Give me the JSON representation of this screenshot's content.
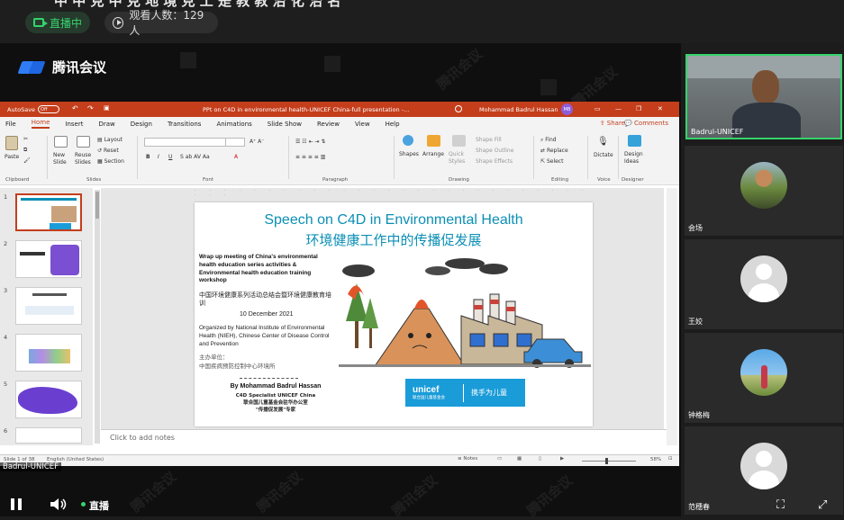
{
  "topbar": {
    "title_cut": "中 中 見 中 見 地 境 見 工 是 教 教 治 化 治 名",
    "live_label": "直播中",
    "viewers_label": "观看人数：129人"
  },
  "meeting": {
    "brand": "腾讯会议",
    "watermark": "腾讯会议",
    "presenter_label": "Badrul-UNICEF"
  },
  "ppt": {
    "autosave_label": "AutoSave",
    "autosave_state": "Off",
    "doc_title": "PPt on C4D in environmental health-UNICEF China-full presentation -...",
    "user_name": "Mohammad Badrul Hassan",
    "user_initials": "MB",
    "tabs": [
      "File",
      "Home",
      "Insert",
      "Draw",
      "Design",
      "Transitions",
      "Animations",
      "Slide Show",
      "Review",
      "View",
      "Help"
    ],
    "share_label": "Share",
    "comments_label": "Comments",
    "ribbon": {
      "paste": "Paste",
      "clipboard": "Clipboard",
      "new_slide": "New Slide",
      "reuse_slides": "Reuse Slides",
      "layout": "Layout",
      "reset": "Reset",
      "section": "Section",
      "slides": "Slides",
      "font": "Font",
      "paragraph": "Paragraph",
      "shapes": "Shapes",
      "arrange": "Arrange",
      "quick_styles": "Quick Styles",
      "shape_fill": "Shape Fill",
      "shape_outline": "Shape Outline",
      "shape_effects": "Shape Effects",
      "drawing": "Drawing",
      "find": "Find",
      "replace": "Replace",
      "select": "Select",
      "editing": "Editing",
      "dictate": "Dictate",
      "voice": "Voice",
      "design_ideas": "Design Ideas",
      "designer": "Designer"
    },
    "thumb_numbers": [
      "1",
      "2",
      "3",
      "4",
      "5",
      "6"
    ],
    "notes_placeholder": "Click to add notes",
    "status_slide": "Slide 1 of 38",
    "status_lang": "English (United States)",
    "status_notes": "Notes",
    "status_zoom": "58%"
  },
  "slide": {
    "title_en": "Speech on C4D in Environmental Health",
    "title_cn": "环境健康工作中的传播促发展",
    "meeting_en": "Wrap up meeting of China's environmental health education series activities & Environmental health education training workshop",
    "meeting_cn": "中国环境健康系列活动总结会暨环境健康教育培训",
    "date": "10 December 2021",
    "org_en": "Organized by National Institute of Environmental Health (NIEH), Chinese Center of Disease Control and Prevention",
    "org_cn_1": "主办单位：",
    "org_cn_2": "中国疾病预防控制中心环境所",
    "by": "By Mohammad Badrul Hassan",
    "role_1": "C4D Specialist UNICEF China",
    "role_2": "联合国儿童基金会驻华办公室",
    "role_3": "\"传播促发展\"专家",
    "unicef_logo": "unicef",
    "unicef_sub": "联合国儿童基金会",
    "unicef_slogan": "携手为儿童"
  },
  "participants": [
    {
      "name": "Badrul-UNICEF"
    },
    {
      "name": "会场"
    },
    {
      "name": "王姣"
    },
    {
      "name": "钟格梅"
    },
    {
      "name": "范穗春"
    }
  ],
  "controls": {
    "live_label": "直播"
  }
}
